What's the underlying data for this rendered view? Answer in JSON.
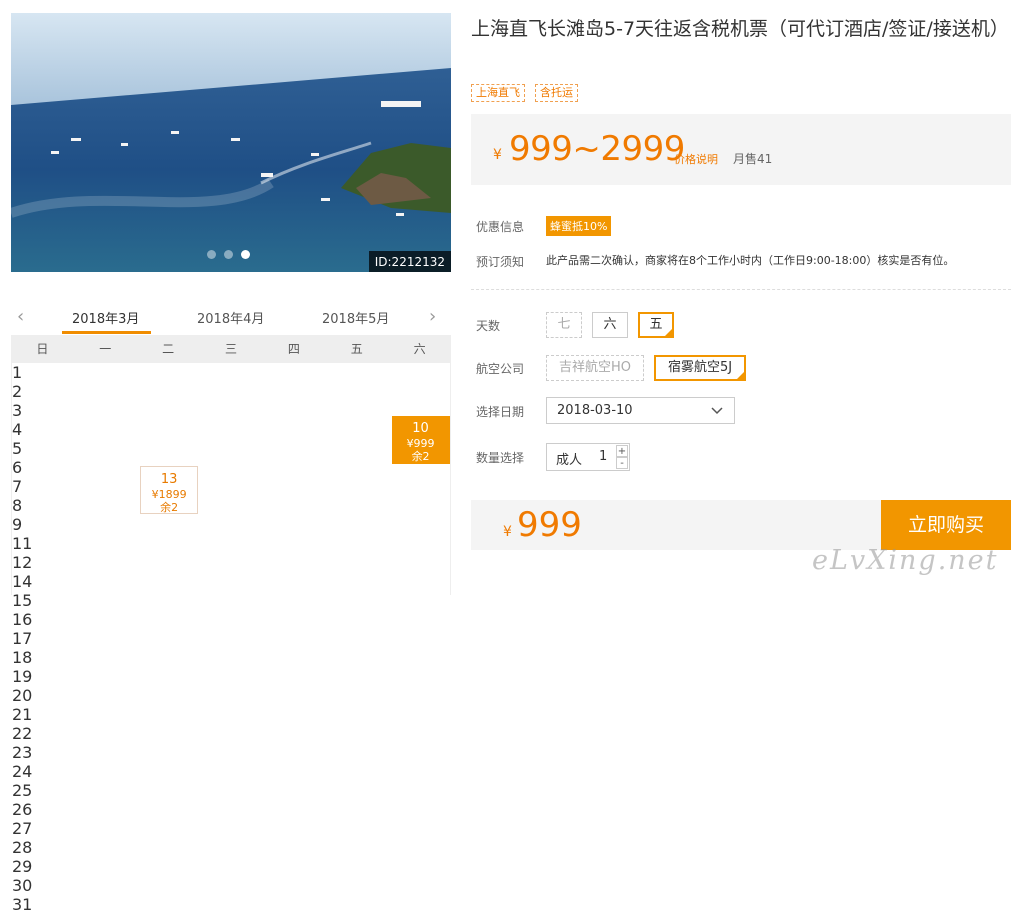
{
  "gallery": {
    "image_id": "ID:2212132",
    "dots": 3,
    "active_dot": 2
  },
  "product": {
    "title": "上海直飞长滩岛5-7天往返含税机票（可代订酒店/签证/接送机）",
    "tags": [
      "上海直飞",
      "含托运"
    ],
    "price_currency": "¥",
    "price_range": "999~2999",
    "price_explain": "价格说明",
    "monthly_sales": "月售41"
  },
  "info": {
    "promo_label": "优惠信息",
    "promo_badge": "蜂蜜抵10%",
    "notice_label": "预订须知",
    "notice_text": "此产品需二次确认，商家将在8个工作小时内（工作日9:00-18:00）核实是否有位。"
  },
  "options": {
    "days_label": "天数",
    "days": [
      {
        "label": "七",
        "state": "disabled"
      },
      {
        "label": "六",
        "state": "normal"
      },
      {
        "label": "五",
        "state": "selected"
      }
    ],
    "airline_label": "航空公司",
    "airlines": [
      {
        "label": "吉祥航空HO",
        "state": "disabled"
      },
      {
        "label": "宿雾航空5J",
        "state": "selected"
      }
    ],
    "date_label": "选择日期",
    "date_value": "2018-03-10",
    "qty_label": "数量选择",
    "qty_type": "成人",
    "qty_value": "1",
    "qty_plus": "+",
    "qty_minus": "-"
  },
  "buy": {
    "currency": "¥",
    "amount": "999",
    "button": "立即购买"
  },
  "calendar": {
    "prev_arrow": "‹",
    "next_arrow": "›",
    "months": [
      "2018年3月",
      "2018年4月",
      "2018年5月"
    ],
    "active_month": 0,
    "weekdays": [
      "日",
      "一",
      "二",
      "三",
      "四",
      "五",
      "六"
    ],
    "first_weekday": 4,
    "visible_days": 31,
    "special": {
      "10": {
        "price": "¥999",
        "stock": "余2",
        "state": "selected"
      },
      "13": {
        "price": "¥1899",
        "stock": "余2",
        "state": "available"
      }
    }
  },
  "watermark": "eLvXing.net",
  "colors": {
    "accent": "#f29600",
    "price": "#f07a00"
  }
}
